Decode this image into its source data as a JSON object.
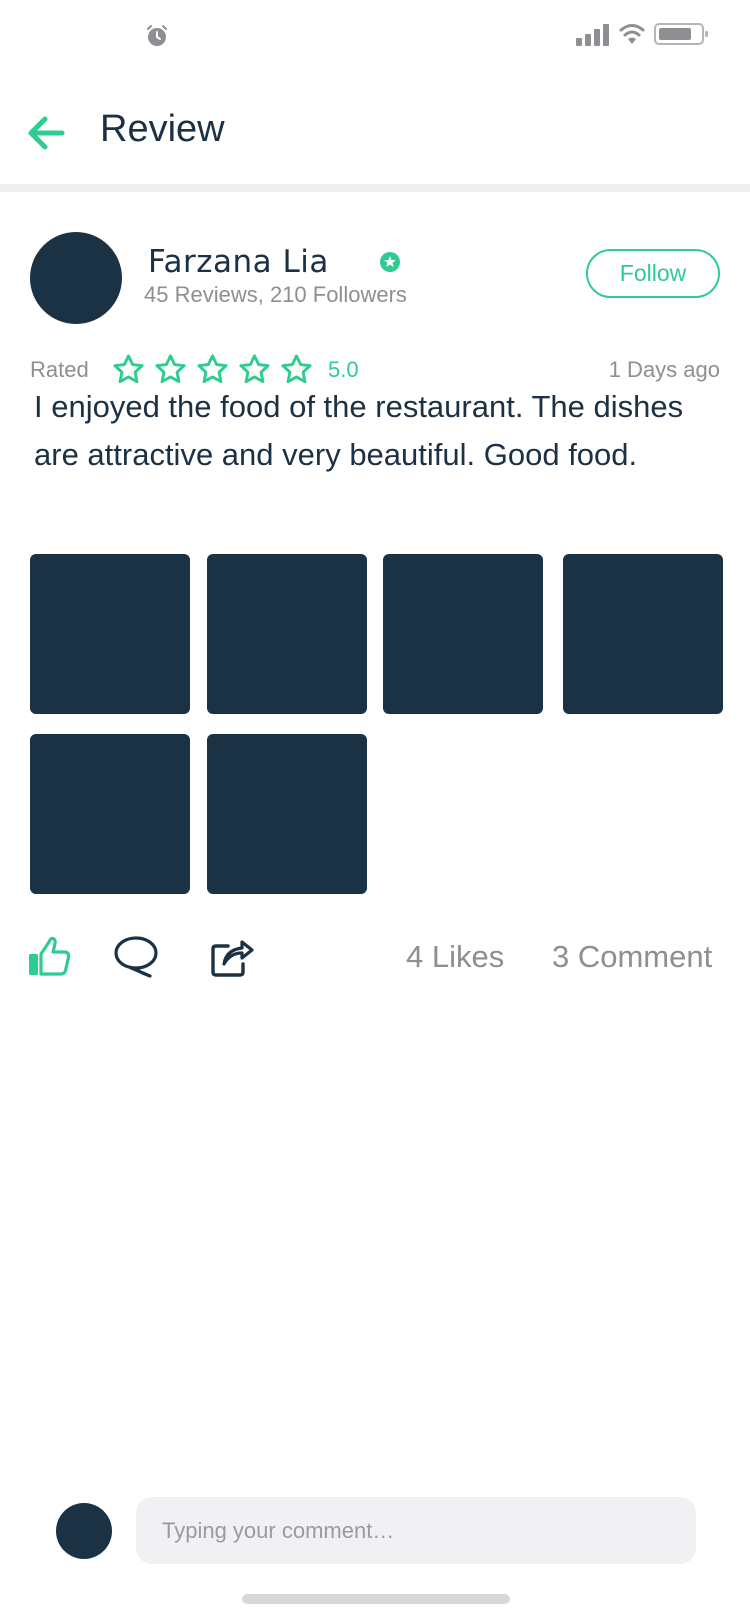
{
  "status_bar": {
    "icons": [
      "alarm-icon",
      "signal-icon",
      "wifi-icon",
      "battery-icon"
    ]
  },
  "header": {
    "title": "Review",
    "back_icon": "arrow-left-icon"
  },
  "reviewer": {
    "name": "Farzana Lia",
    "stats": "45 Reviews, 210 Followers",
    "follow_label": "Follow",
    "verified_icon": "verified-star-icon"
  },
  "rating": {
    "label": "Rated",
    "stars": 5,
    "value": "5.0",
    "date": "1 Days ago"
  },
  "review": {
    "text": "I enjoyed the food of the restaurant. The dishes are attractive and very beautiful. Good food.",
    "photo_count": 6
  },
  "actions": {
    "likes": "4 Likes",
    "comments": "3 Comment",
    "icons": [
      "thumbs-up-icon",
      "comment-icon",
      "share-icon"
    ]
  },
  "comment_bar": {
    "placeholder": "Typing your comment…"
  },
  "colors": {
    "accent": "#2ECC8F",
    "dark": "#1B3244",
    "muted": "#8E8E93",
    "input_bg": "#F1F1F3"
  }
}
